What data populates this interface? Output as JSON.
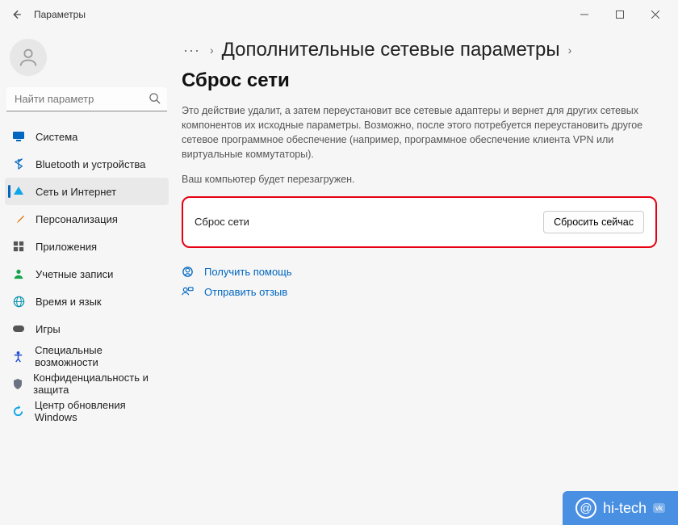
{
  "window": {
    "title": "Параметры"
  },
  "search": {
    "placeholder": "Найти параметр"
  },
  "sidebar": {
    "items": [
      {
        "label": "Система",
        "icon": "monitor-icon",
        "color": "#0067c0"
      },
      {
        "label": "Bluetooth и устройства",
        "icon": "bluetooth-icon",
        "color": "#0067c0"
      },
      {
        "label": "Сеть и Интернет",
        "icon": "wifi-icon",
        "color": "#0ea5e9",
        "active": true
      },
      {
        "label": "Персонализация",
        "icon": "brush-icon",
        "color": "#d97706"
      },
      {
        "label": "Приложения",
        "icon": "apps-icon",
        "color": "#555"
      },
      {
        "label": "Учетные записи",
        "icon": "user-icon",
        "color": "#16a34a"
      },
      {
        "label": "Время и язык",
        "icon": "globe-icon",
        "color": "#0891b2"
      },
      {
        "label": "Игры",
        "icon": "game-icon",
        "color": "#555"
      },
      {
        "label": "Специальные возможности",
        "icon": "accessibility-icon",
        "color": "#1d4ed8"
      },
      {
        "label": "Конфиденциальность и защита",
        "icon": "shield-icon",
        "color": "#6b7280"
      },
      {
        "label": "Центр обновления Windows",
        "icon": "update-icon",
        "color": "#0ea5e9"
      }
    ]
  },
  "breadcrumb": {
    "prev": "Дополнительные сетевые параметры",
    "current": "Сброс сети"
  },
  "main": {
    "description": "Это действие удалит, а затем переустановит все сетевые адаптеры и вернет для других сетевых компонентов их исходные параметры. Возможно, после этого потребуется переустановить другое сетевое программное обеспечение (например, программное обеспечение клиента VPN или виртуальные коммутаторы).",
    "reboot_note": "Ваш компьютер будет перезагружен.",
    "card_label": "Сброс сети",
    "reset_button": "Сбросить сейчас"
  },
  "links": {
    "help": "Получить помощь",
    "feedback": "Отправить отзыв"
  },
  "watermark": {
    "text": "hi-tech"
  }
}
